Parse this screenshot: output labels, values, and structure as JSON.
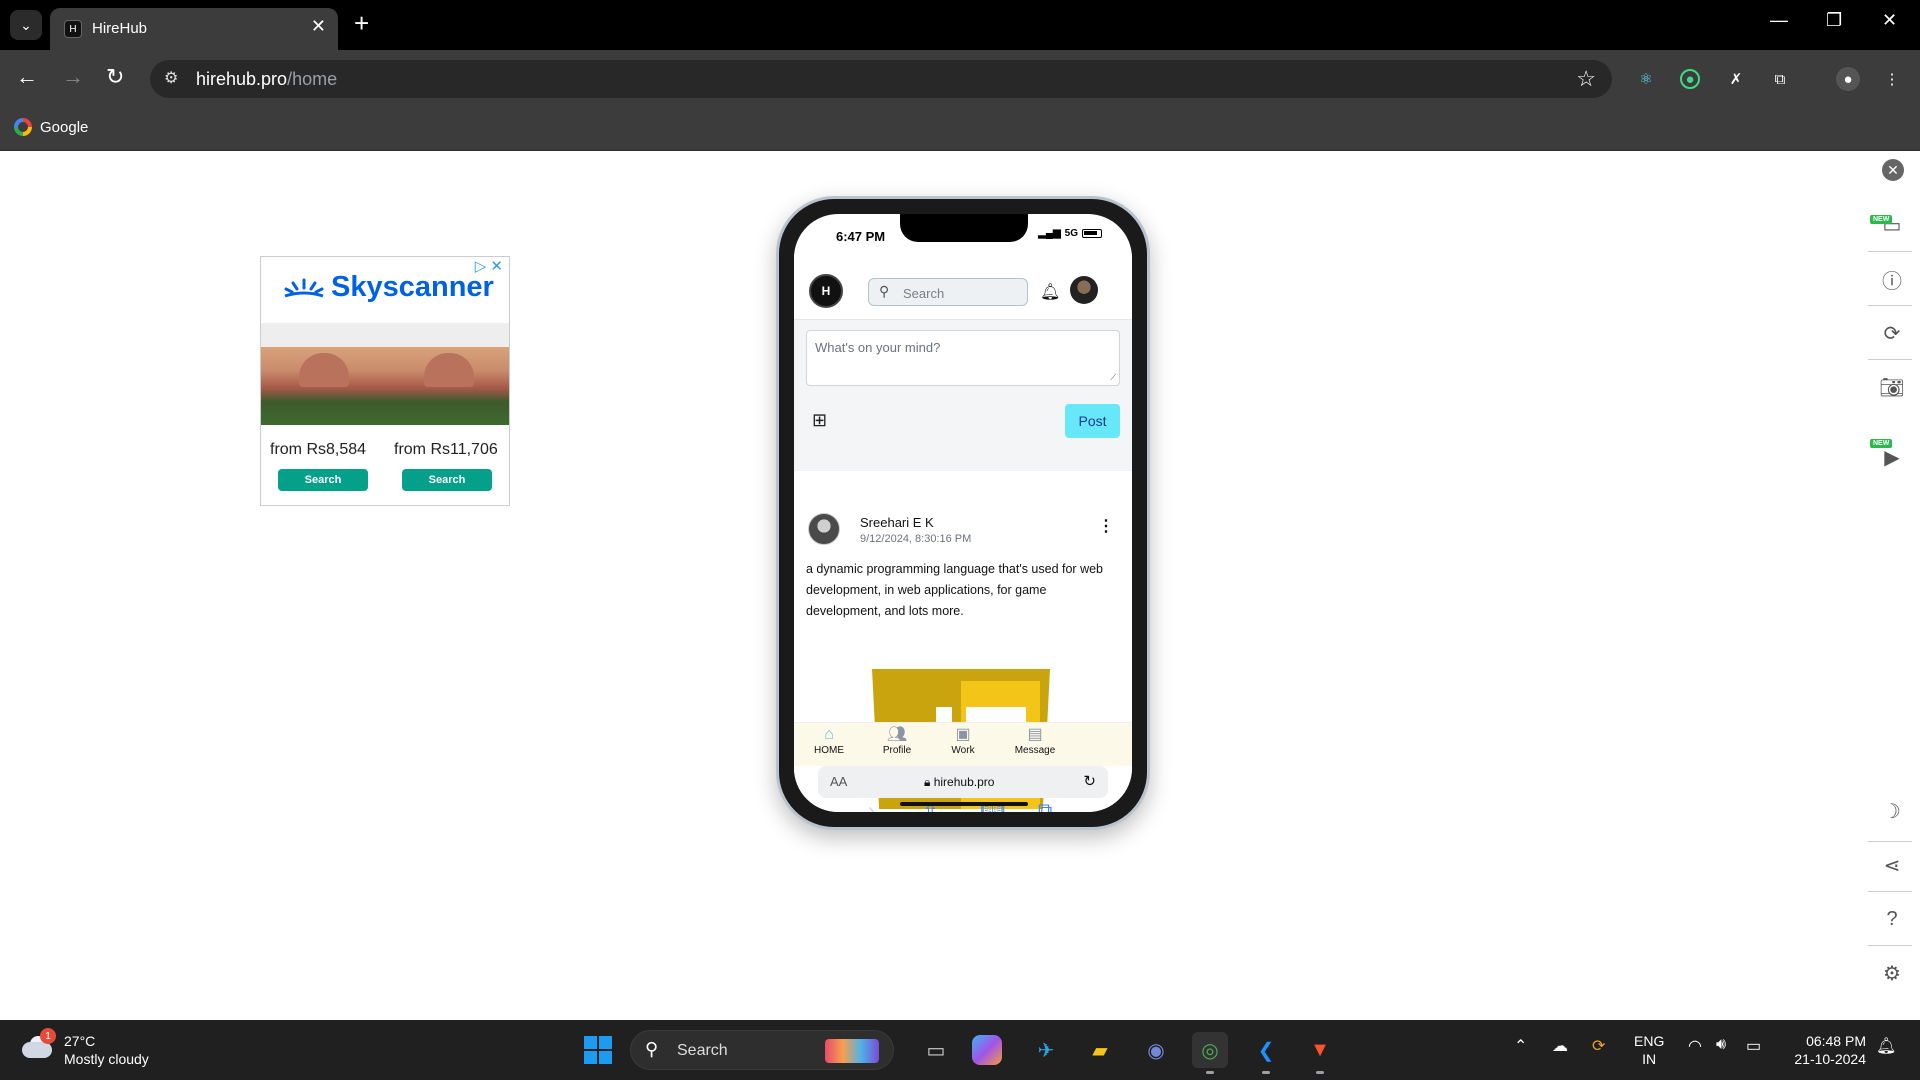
{
  "browser": {
    "tab_title": "HireHub",
    "tab_favicon": "H",
    "url_host": "hirehub.pro",
    "url_path": "/home",
    "bookmark": "Google",
    "new_tab_glyph": "+"
  },
  "ad": {
    "brand": "Skyscanner",
    "price_1": "from Rs8,584",
    "price_2": "from Rs11,706",
    "button_1": "Search",
    "button_2": "Search",
    "accent": "#0062e3",
    "button_color": "#05a08a"
  },
  "phone": {
    "status_time": "6:47 PM",
    "network": "5G",
    "app": {
      "logo": "H",
      "search_placeholder": "Search",
      "composer_placeholder": "What's on your mind?",
      "post_button": "Post",
      "post": {
        "author": "Sreehari E K",
        "timestamp": "9/12/2024, 8:30:16 PM",
        "text": "a dynamic programming language that's used for web development, in web applications, for game development, and lots more."
      },
      "nav": [
        {
          "label": "HOME",
          "icon": "home-icon",
          "active": true
        },
        {
          "label": "Profile",
          "icon": "people-icon",
          "active": false
        },
        {
          "label": "Work",
          "icon": "briefcase-icon",
          "active": false
        },
        {
          "label": "Message",
          "icon": "message-icon",
          "active": false
        }
      ]
    },
    "safari": {
      "aa": "AA",
      "host": "hirehub.pro"
    }
  },
  "taskbar": {
    "temperature": "27°C",
    "weather": "Mostly cloudy",
    "weather_badge": "1",
    "search_label": "Search",
    "lang_1": "ENG",
    "lang_2": "IN",
    "time": "06:48 PM",
    "date": "21-10-2024"
  }
}
